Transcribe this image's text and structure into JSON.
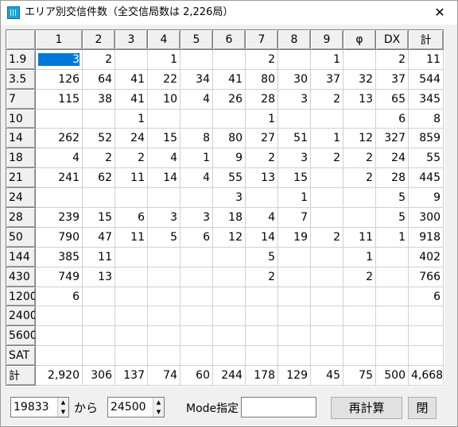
{
  "window": {
    "title": "エリア別交信件数（全交信局数は 2,226局）",
    "close_glyph": "✕"
  },
  "table": {
    "columns": [
      "1",
      "2",
      "3",
      "4",
      "5",
      "6",
      "7",
      "8",
      "9",
      "φ",
      "DX",
      "計"
    ],
    "rows": [
      {
        "label": "1.9",
        "cells": [
          "3",
          "2",
          "",
          "1",
          "",
          "",
          "2",
          "",
          "1",
          "",
          "2",
          "11"
        ]
      },
      {
        "label": "3.5",
        "cells": [
          "126",
          "64",
          "41",
          "22",
          "34",
          "41",
          "80",
          "30",
          "37",
          "32",
          "37",
          "544"
        ]
      },
      {
        "label": "7",
        "cells": [
          "115",
          "38",
          "41",
          "10",
          "4",
          "26",
          "28",
          "3",
          "2",
          "13",
          "65",
          "345"
        ]
      },
      {
        "label": "10",
        "cells": [
          "",
          "",
          "1",
          "",
          "",
          "",
          "1",
          "",
          "",
          "",
          "6",
          "8"
        ]
      },
      {
        "label": "14",
        "cells": [
          "262",
          "52",
          "24",
          "15",
          "8",
          "80",
          "27",
          "51",
          "1",
          "12",
          "327",
          "859"
        ]
      },
      {
        "label": "18",
        "cells": [
          "4",
          "2",
          "2",
          "4",
          "1",
          "9",
          "2",
          "3",
          "2",
          "2",
          "24",
          "55"
        ]
      },
      {
        "label": "21",
        "cells": [
          "241",
          "62",
          "11",
          "14",
          "4",
          "55",
          "13",
          "15",
          "",
          "2",
          "28",
          "445"
        ]
      },
      {
        "label": "24",
        "cells": [
          "",
          "",
          "",
          "",
          "",
          "3",
          "",
          "1",
          "",
          "",
          "5",
          "9"
        ]
      },
      {
        "label": "28",
        "cells": [
          "239",
          "15",
          "6",
          "3",
          "3",
          "18",
          "4",
          "7",
          "",
          "",
          "5",
          "300"
        ]
      },
      {
        "label": "50",
        "cells": [
          "790",
          "47",
          "11",
          "5",
          "6",
          "12",
          "14",
          "19",
          "2",
          "11",
          "1",
          "918"
        ]
      },
      {
        "label": "144",
        "cells": [
          "385",
          "11",
          "",
          "",
          "",
          "",
          "5",
          "",
          "",
          "1",
          "",
          "402"
        ]
      },
      {
        "label": "430",
        "cells": [
          "749",
          "13",
          "",
          "",
          "",
          "",
          "2",
          "",
          "",
          "2",
          "",
          "766"
        ]
      },
      {
        "label": "1200",
        "cells": [
          "6",
          "",
          "",
          "",
          "",
          "",
          "",
          "",
          "",
          "",
          "",
          "6"
        ]
      },
      {
        "label": "2400",
        "cells": [
          "",
          "",
          "",
          "",
          "",
          "",
          "",
          "",
          "",
          "",
          "",
          ""
        ]
      },
      {
        "label": "5600",
        "cells": [
          "",
          "",
          "",
          "",
          "",
          "",
          "",
          "",
          "",
          "",
          "",
          ""
        ]
      },
      {
        "label": "SAT",
        "cells": [
          "",
          "",
          "",
          "",
          "",
          "",
          "",
          "",
          "",
          "",
          "",
          ""
        ]
      },
      {
        "label": "計",
        "cells": [
          "2,920",
          "306",
          "137",
          "74",
          "60",
          "244",
          "178",
          "129",
          "45",
          "75",
          "500",
          "4,668"
        ]
      }
    ]
  },
  "controls": {
    "from_value": "19833",
    "from_label": "から",
    "to_value": "24500",
    "mode_label": "Mode指定",
    "mode_value": "",
    "recalc_button": "再計算",
    "close_button": "閉",
    "spin_up": "▲",
    "spin_down": "▼"
  },
  "colors": {
    "selection": "#0078d7",
    "header_bg": "#f0f0f0"
  }
}
